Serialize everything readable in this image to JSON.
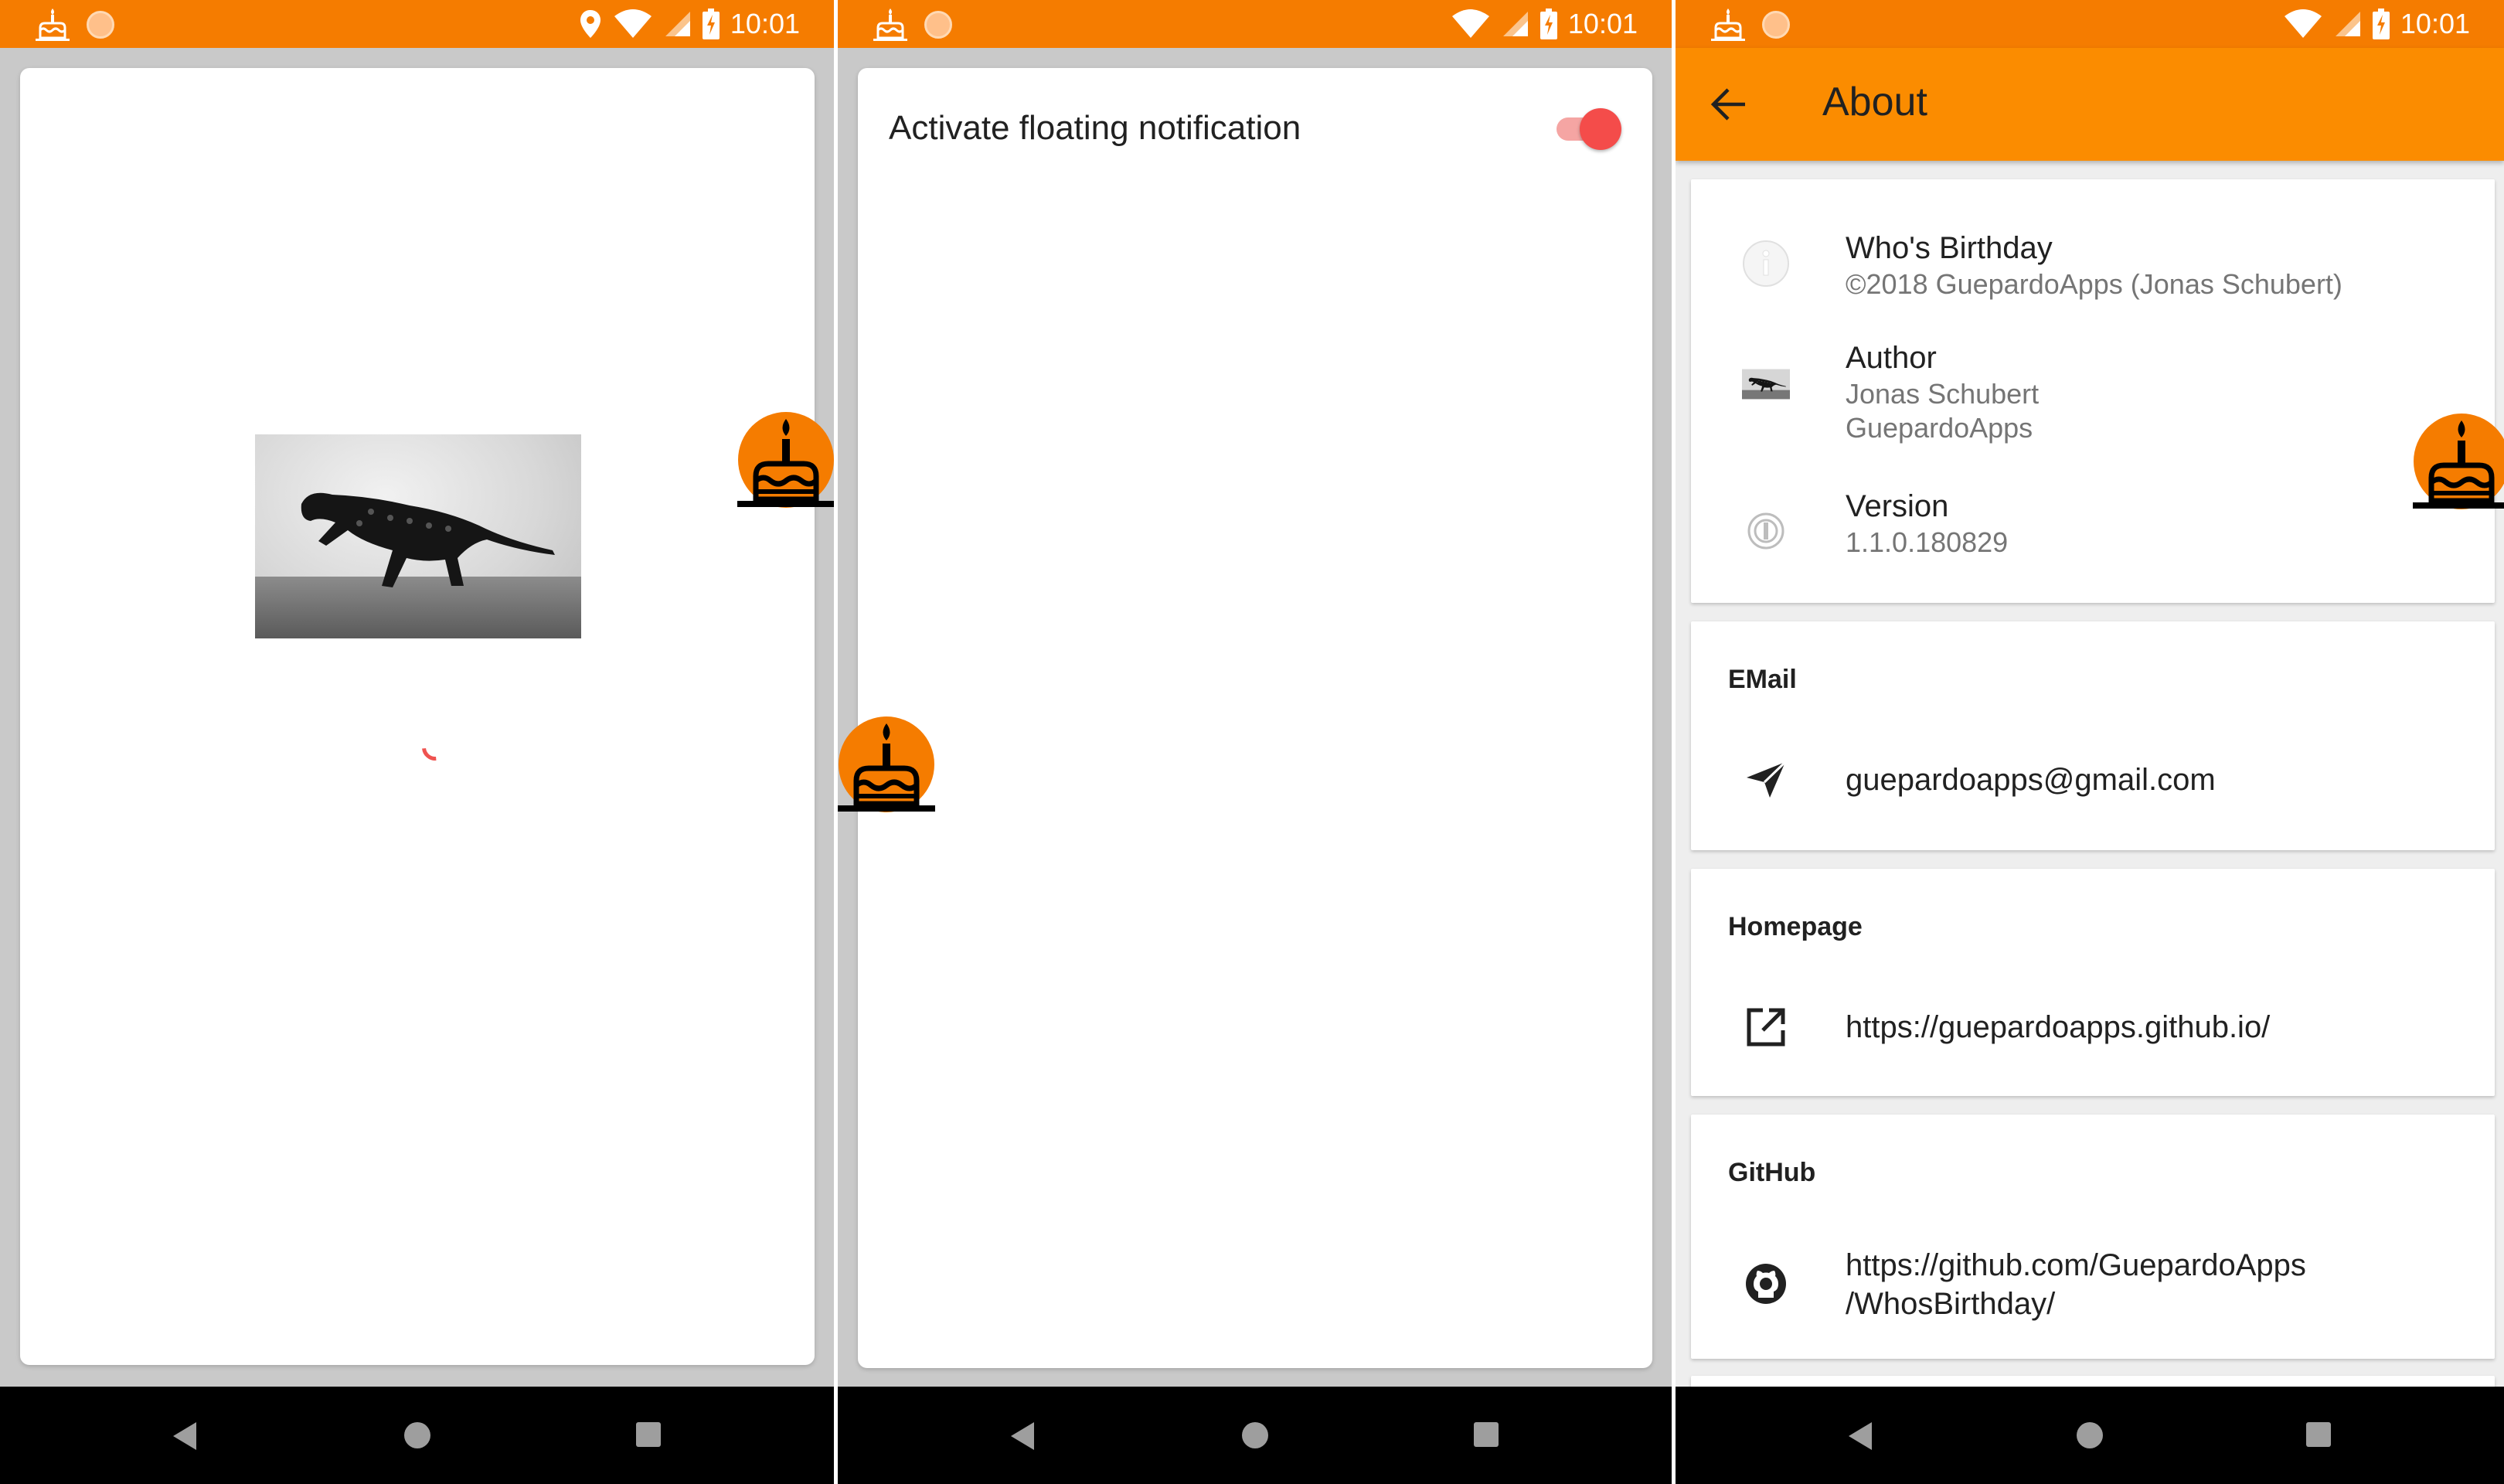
{
  "status_bar": {
    "time": "10:01"
  },
  "screen2": {
    "floating_notification": {
      "label": "Activate floating notification",
      "enabled": true
    }
  },
  "screen3": {
    "appbar": {
      "title": "About"
    },
    "app_info": {
      "name": "Who's Birthday",
      "copyright": "©2018 GuepardoApps (Jonas Schubert)",
      "author_label": "Author",
      "author_name": "Jonas Schubert",
      "author_company": "GuepardoApps",
      "version_label": "Version",
      "version_value": "1.1.0.180829"
    },
    "email": {
      "heading": "EMail",
      "value": "guepardoapps@gmail.com"
    },
    "homepage": {
      "heading": "Homepage",
      "value": "https://guepardoapps.github.io/"
    },
    "github": {
      "heading": "GitHub",
      "value_line1": "https://github.com/GuepardoApps",
      "value_line2": "/WhosBirthday/"
    }
  },
  "icons": {
    "status_left": [
      "cake-icon",
      "notification-dot-icon"
    ],
    "status_right": [
      "location-icon",
      "wifi-icon",
      "signal-icon",
      "battery-charging-icon"
    ],
    "navigation": [
      "back-triangle-icon",
      "home-circle-icon",
      "recents-square-icon"
    ],
    "about": [
      "info-icon",
      "author-avatar",
      "version-icon",
      "send-icon",
      "open-in-new-icon",
      "github-icon"
    ]
  },
  "colors": {
    "status_bar": "#f57c00",
    "app_bar": "#fb8c00",
    "switch_on": "#f44c4a",
    "background_gray": "#c9c9c9"
  }
}
